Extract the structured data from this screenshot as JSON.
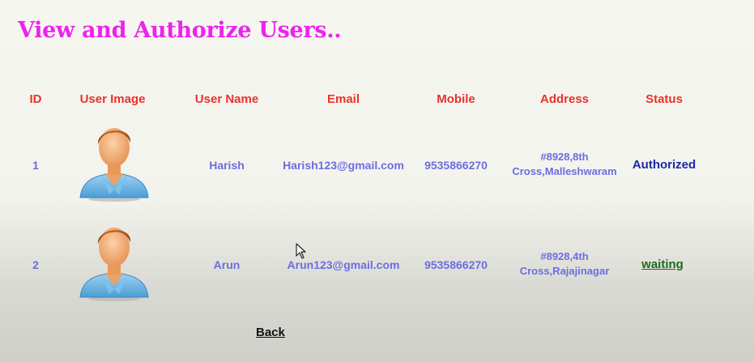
{
  "page": {
    "title": "View and Authorize Users.."
  },
  "table": {
    "headers": [
      "ID",
      "User Image",
      "User Name",
      "Email",
      "Mobile",
      "Address",
      "Status"
    ],
    "rows": [
      {
        "id": "1",
        "image_icon": "user-avatar-icon",
        "name": "Harish",
        "email": "Harish123@gmail.com",
        "mobile": "9535866270",
        "address_line1": "#8928,8th",
        "address_line2": "Cross,Malleshwaram",
        "status": "Authorized"
      },
      {
        "id": "2",
        "image_icon": "user-avatar-icon",
        "name": "Arun",
        "email": "Arun123@gmail.com",
        "mobile": "9535866270",
        "address_line1": "#8928,4th",
        "address_line2": "Cross,Rajajinagar",
        "status": "waiting"
      }
    ]
  },
  "footer": {
    "back_label": "Back"
  },
  "colors": {
    "title": "#ee22ee",
    "header": "#e8332a",
    "cell": "#6a6ee0",
    "authorized": "#1c27a4",
    "waiting": "#1c6b1f"
  },
  "icons": {
    "cursor": "mouse-pointer-icon"
  }
}
